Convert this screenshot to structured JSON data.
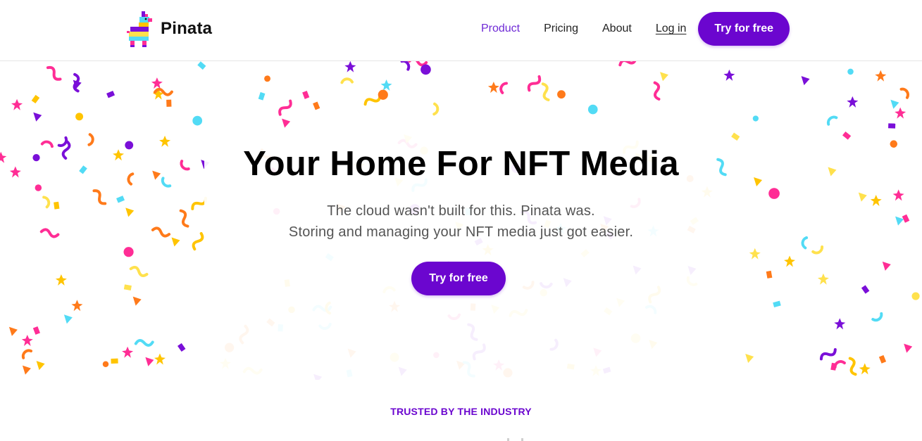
{
  "brand": {
    "name": "Pinata",
    "logo_icon": "pinata-llama-icon"
  },
  "nav": {
    "items": [
      "Product",
      "Pricing",
      "About"
    ],
    "active": "Product",
    "login_label": "Log in",
    "cta_label": "Try for free"
  },
  "hero": {
    "title": "Your Home For NFT Media",
    "subtitle_line1": "The cloud wasn't built for this. Pinata was.",
    "subtitle_line2": "Storing and managing your NFT media just got easier.",
    "cta_label": "Try for free",
    "background": "confetti-pattern"
  },
  "trusted": {
    "label": "TRUSTED BY THE INDUSTRY"
  },
  "colors": {
    "accent": "#6b06cf",
    "nav_active": "#6f2ad6",
    "confetti": [
      "#7a0fd8",
      "#ff2d95",
      "#ffc400",
      "#ff7a1a",
      "#52dbf5",
      "#ffe14d"
    ]
  }
}
